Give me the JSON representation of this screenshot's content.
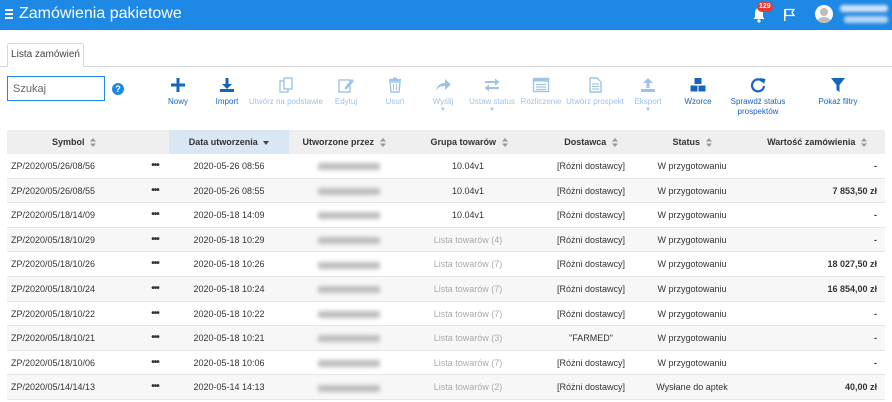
{
  "app": {
    "title": "Zamówienia pakietowe",
    "notifications_count": "129"
  },
  "tabs": [
    {
      "label": "Lista zamówień"
    }
  ],
  "search": {
    "placeholder": "Szukaj",
    "value": "",
    "help": "?"
  },
  "toolbar": [
    {
      "label": "Nowy",
      "icon": "plus-icon",
      "enabled": true
    },
    {
      "label": "Import",
      "icon": "download-icon",
      "enabled": true
    },
    {
      "label": "Utwórz na podstawie",
      "icon": "copy-icon",
      "enabled": false
    },
    {
      "label": "Edytuj",
      "icon": "edit-icon",
      "enabled": false
    },
    {
      "label": "Usuń",
      "icon": "trash-icon",
      "enabled": false
    },
    {
      "label": "Wyślij",
      "icon": "share-icon",
      "enabled": false,
      "dropdown": true
    },
    {
      "label": "Ustaw status",
      "icon": "exchange-icon",
      "enabled": false,
      "dropdown": true
    },
    {
      "label": "Rozliczenie",
      "icon": "calculator-icon",
      "enabled": false
    },
    {
      "label": "Utwórz prospekt",
      "icon": "document-icon",
      "enabled": false
    },
    {
      "label": "Eksport",
      "icon": "upload-icon",
      "enabled": false,
      "dropdown": true
    },
    {
      "label": "Wzorce",
      "icon": "cubes-icon",
      "enabled": true
    },
    {
      "label": "Sprawdź status prospektów",
      "icon": "refresh-icon",
      "enabled": true
    },
    {
      "label": "Pokaż filtry",
      "icon": "filter-icon",
      "enabled": true
    }
  ],
  "table": {
    "columns": [
      "Symbol",
      "",
      "Data utworzenia",
      "Utworzone przez",
      "Grupa towarów",
      "Dostawca",
      "Status",
      "Wartość zamówienia"
    ],
    "sorted_column": "Data utworzenia",
    "rows": [
      {
        "symbol": "ZP/2020/05/26/08/56",
        "actions": "•••",
        "date": "2020-05-26 08:56",
        "group": "10.04v1",
        "group_muted": false,
        "supplier": "[Różni dostawcy]",
        "status": "W przygotowaniu",
        "value": "-"
      },
      {
        "symbol": "ZP/2020/05/26/08/55",
        "actions": "•••",
        "date": "2020-05-26 08:55",
        "group": "10.04v1",
        "group_muted": false,
        "supplier": "[Różni dostawcy]",
        "status": "W przygotowaniu",
        "value": "7 853,50 zł"
      },
      {
        "symbol": "ZP/2020/05/18/14/09",
        "actions": "•••",
        "date": "2020-05-18 14:09",
        "group": "10.04v1",
        "group_muted": false,
        "supplier": "[Różni dostawcy]",
        "status": "W przygotowaniu",
        "value": "-"
      },
      {
        "symbol": "ZP/2020/05/18/10/29",
        "actions": "•••",
        "date": "2020-05-18 10:29",
        "group": "Lista towarów (4)",
        "group_muted": true,
        "supplier": "[Różni dostawcy]",
        "status": "W przygotowaniu",
        "value": "-"
      },
      {
        "symbol": "ZP/2020/05/18/10/26",
        "actions": "•••",
        "date": "2020-05-18 10:26",
        "group": "Lista towarów (7)",
        "group_muted": true,
        "supplier": "[Różni dostawcy]",
        "status": "W przygotowaniu",
        "value": "18 027,50 zł"
      },
      {
        "symbol": "ZP/2020/05/18/10/24",
        "actions": "•••",
        "date": "2020-05-18 10:24",
        "group": "Lista towarów (7)",
        "group_muted": true,
        "supplier": "[Różni dostawcy]",
        "status": "W przygotowaniu",
        "value": "16 854,00 zł"
      },
      {
        "symbol": "ZP/2020/05/18/10/22",
        "actions": "•••",
        "date": "2020-05-18 10:22",
        "group": "Lista towarów (7)",
        "group_muted": true,
        "supplier": "[Różni dostawcy]",
        "status": "W przygotowaniu",
        "value": "-"
      },
      {
        "symbol": "ZP/2020/05/18/10/21",
        "actions": "•••",
        "date": "2020-05-18 10:21",
        "group": "Lista towarów (3)",
        "group_muted": true,
        "supplier": "\"FARMED\"",
        "status": "W przygotowaniu",
        "value": "-"
      },
      {
        "symbol": "ZP/2020/05/18/10/06",
        "actions": "•••",
        "date": "2020-05-18 10:06",
        "group": "Lista towarów (7)",
        "group_muted": true,
        "supplier": "[Różni dostawcy]",
        "status": "W przygotowaniu",
        "value": "-"
      },
      {
        "symbol": "ZP/2020/05/14/14/13",
        "actions": "•••",
        "date": "2020-05-14 14:13",
        "group": "Lista towarów (2)",
        "group_muted": true,
        "supplier": "[Różni dostawcy]",
        "status": "Wysłane do aptek",
        "value": "40,00 zł"
      }
    ]
  },
  "colors": {
    "primary": "#1e88e5",
    "accent_text": "#1565c0",
    "disabled_text": "#9fc3e6",
    "badge": "#e53935"
  }
}
